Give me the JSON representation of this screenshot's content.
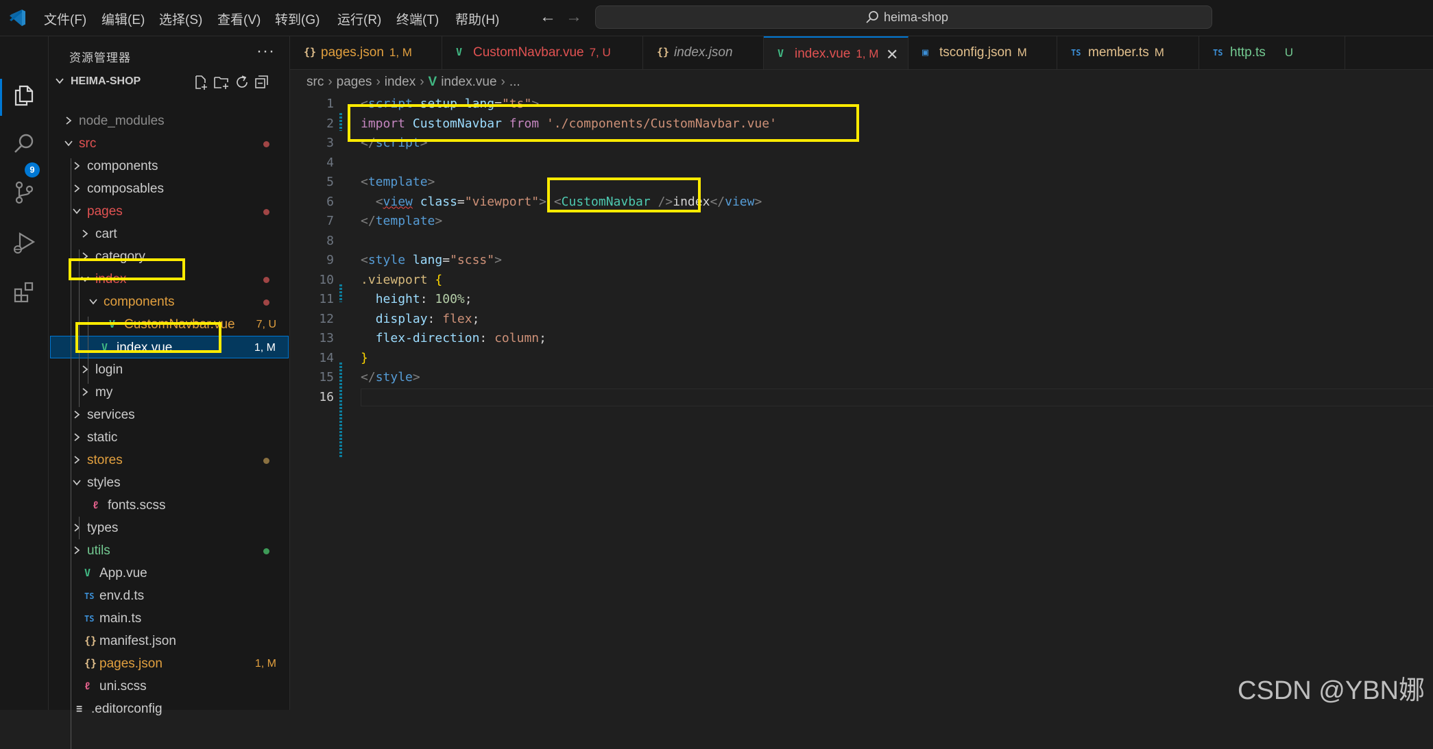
{
  "menu": {
    "items": [
      "文件(F)",
      "编辑(E)",
      "选择(S)",
      "查看(V)",
      "转到(G)",
      "运行(R)",
      "终端(T)",
      "帮助(H)"
    ]
  },
  "nav": {
    "back": "←",
    "forward": "→"
  },
  "search": {
    "text": "heima-shop"
  },
  "activity": {
    "scm_badge": "9"
  },
  "sidebar": {
    "title": "资源管理器",
    "more": "···",
    "workspace": "HEIMA-SHOP",
    "tree": [
      {
        "label": "node_modules",
        "type": "folder",
        "expanded": false,
        "depth": 1,
        "color": "#8c8c8c"
      },
      {
        "label": "src",
        "type": "folder",
        "expanded": true,
        "depth": 1,
        "color": "#e05252",
        "dot": "#a04545"
      },
      {
        "label": "components",
        "type": "folder",
        "expanded": false,
        "depth": 2,
        "color": "#cccccc"
      },
      {
        "label": "composables",
        "type": "folder",
        "expanded": false,
        "depth": 2,
        "color": "#cccccc"
      },
      {
        "label": "pages",
        "type": "folder",
        "expanded": true,
        "depth": 2,
        "color": "#e05252",
        "dot": "#a04545"
      },
      {
        "label": "cart",
        "type": "folder",
        "expanded": false,
        "depth": 3,
        "color": "#cccccc"
      },
      {
        "label": "category",
        "type": "folder",
        "expanded": false,
        "depth": 3,
        "color": "#cccccc"
      },
      {
        "label": "index",
        "type": "folder",
        "expanded": true,
        "depth": 3,
        "color": "#e05252",
        "dot": "#a04545"
      },
      {
        "label": "components",
        "type": "folder",
        "expanded": true,
        "depth": 4,
        "color": "#e2a03f",
        "dot": "#a04545"
      },
      {
        "label": "CustomNavbar.vue",
        "type": "vue",
        "depth": 5,
        "color": "#e2a03f",
        "badge": "7, U",
        "badge_color": "#e2a03f"
      },
      {
        "label": "index.vue",
        "type": "vue",
        "depth": 4,
        "color": "#ffffff",
        "badge": "1, M",
        "badge_color": "#ffffff",
        "selected": true
      },
      {
        "label": "login",
        "type": "folder",
        "expanded": false,
        "depth": 3,
        "color": "#cccccc"
      },
      {
        "label": "my",
        "type": "folder",
        "expanded": false,
        "depth": 3,
        "color": "#cccccc"
      },
      {
        "label": "services",
        "type": "folder",
        "expanded": false,
        "depth": 2,
        "color": "#cccccc"
      },
      {
        "label": "static",
        "type": "folder",
        "expanded": false,
        "depth": 2,
        "color": "#cccccc"
      },
      {
        "label": "stores",
        "type": "folder",
        "expanded": false,
        "depth": 2,
        "color": "#e2a03f",
        "dot": "#8a7040"
      },
      {
        "label": "styles",
        "type": "folder",
        "expanded": true,
        "depth": 2,
        "color": "#cccccc"
      },
      {
        "label": "fonts.scss",
        "type": "scss",
        "depth": 3,
        "color": "#cccccc"
      },
      {
        "label": "types",
        "type": "folder",
        "expanded": false,
        "depth": 2,
        "color": "#cccccc"
      },
      {
        "label": "utils",
        "type": "folder",
        "expanded": false,
        "depth": 2,
        "color": "#73c991",
        "dot": "#3d9a57"
      },
      {
        "label": "App.vue",
        "type": "vue",
        "depth": 2,
        "color": "#cccccc"
      },
      {
        "label": "env.d.ts",
        "type": "ts",
        "depth": 2,
        "color": "#cccccc"
      },
      {
        "label": "main.ts",
        "type": "ts",
        "depth": 2,
        "color": "#cccccc"
      },
      {
        "label": "manifest.json",
        "type": "json",
        "depth": 2,
        "color": "#cccccc"
      },
      {
        "label": "pages.json",
        "type": "json",
        "depth": 2,
        "color": "#e2a03f",
        "badge": "1, M",
        "badge_color": "#e2a03f"
      },
      {
        "label": "uni.scss",
        "type": "scss",
        "depth": 2,
        "color": "#cccccc"
      },
      {
        "label": ".editorconfig",
        "type": "config",
        "depth": 1,
        "color": "#cccccc"
      }
    ]
  },
  "tabs": [
    {
      "label": "pages.json",
      "status": "1, M",
      "type": "json",
      "color": "#e2a03f",
      "italic": false
    },
    {
      "label": "CustomNavbar.vue",
      "status": "7, U",
      "type": "vue",
      "color": "#e05252",
      "italic": false
    },
    {
      "label": "index.json",
      "status": "",
      "type": "json",
      "color": "#9d9d9d",
      "italic": true
    },
    {
      "label": "index.vue",
      "status": "1, M",
      "type": "vue",
      "color": "#e05252",
      "italic": false,
      "active": true,
      "close": "✕"
    },
    {
      "label": "tsconfig.json",
      "status": "M",
      "type": "tsconfig",
      "color": "#e2c08d",
      "italic": false
    },
    {
      "label": "member.ts",
      "status": "M",
      "type": "ts",
      "color": "#e2c08d",
      "italic": false
    },
    {
      "label": "http.ts",
      "status": "U",
      "type": "ts",
      "color": "#73c991",
      "italic": false
    }
  ],
  "breadcrumb": {
    "parts": [
      "src",
      "pages",
      "index"
    ],
    "file": "index.vue",
    "tail": "..."
  },
  "editor": {
    "current_line": 16,
    "lines": [
      [
        [
          "<",
          "tk-punc"
        ],
        [
          "script",
          "tk-tag"
        ],
        [
          " ",
          ""
        ],
        [
          "setup",
          "tk-attr"
        ],
        [
          " ",
          ""
        ],
        [
          "lang",
          "tk-attr"
        ],
        [
          "=",
          "tk-text"
        ],
        [
          "\"ts\"",
          "tk-str"
        ],
        [
          ">",
          "tk-punc"
        ]
      ],
      [
        [
          "import",
          "tk-kw"
        ],
        [
          " ",
          ""
        ],
        [
          "CustomNavbar",
          "tk-var"
        ],
        [
          " ",
          ""
        ],
        [
          "from",
          "tk-kw"
        ],
        [
          " ",
          ""
        ],
        [
          "'./components/CustomNavbar.vue'",
          "tk-str"
        ]
      ],
      [
        [
          "</",
          "tk-punc"
        ],
        [
          "script",
          "tk-tag"
        ],
        [
          ">",
          "tk-punc"
        ]
      ],
      [],
      [
        [
          "<",
          "tk-punc"
        ],
        [
          "template",
          "tk-tag"
        ],
        [
          ">",
          "tk-punc"
        ]
      ],
      [
        [
          "  ",
          ""
        ],
        [
          "<",
          "tk-punc"
        ],
        [
          "view",
          "tk-tag squiggle"
        ],
        [
          " ",
          ""
        ],
        [
          "class",
          "tk-attr"
        ],
        [
          "=",
          "tk-text"
        ],
        [
          "\"viewport\"",
          "tk-str"
        ],
        [
          ">",
          "tk-punc"
        ],
        [
          " ",
          ""
        ],
        [
          "<",
          "tk-punc"
        ],
        [
          "CustomNavbar",
          "tk-comp"
        ],
        [
          " ",
          ""
        ],
        [
          "/>",
          "tk-punc"
        ],
        [
          "index",
          "tk-text"
        ],
        [
          "</",
          "tk-punc"
        ],
        [
          "view",
          "tk-tag"
        ],
        [
          ">",
          "tk-punc"
        ]
      ],
      [
        [
          "</",
          "tk-punc"
        ],
        [
          "template",
          "tk-tag"
        ],
        [
          ">",
          "tk-punc"
        ]
      ],
      [],
      [
        [
          "<",
          "tk-punc"
        ],
        [
          "style",
          "tk-tag"
        ],
        [
          " ",
          ""
        ],
        [
          "lang",
          "tk-attr"
        ],
        [
          "=",
          "tk-text"
        ],
        [
          "\"scss\"",
          "tk-str"
        ],
        [
          ">",
          "tk-punc"
        ]
      ],
      [
        [
          ".viewport",
          "tk-sel"
        ],
        [
          " ",
          ""
        ],
        [
          "{",
          "tk-br"
        ]
      ],
      [
        [
          "  ",
          ""
        ],
        [
          "height",
          "tk-attr"
        ],
        [
          ": ",
          "tk-text"
        ],
        [
          "100%",
          "tk-num"
        ],
        [
          ";",
          "tk-text"
        ]
      ],
      [
        [
          "  ",
          ""
        ],
        [
          "display",
          "tk-attr"
        ],
        [
          ": ",
          "tk-text"
        ],
        [
          "flex",
          "tk-str"
        ],
        [
          ";",
          "tk-text"
        ]
      ],
      [
        [
          "  ",
          ""
        ],
        [
          "flex-direction",
          "tk-attr"
        ],
        [
          ": ",
          "tk-text"
        ],
        [
          "column",
          "tk-str"
        ],
        [
          ";",
          "tk-text"
        ]
      ],
      [
        [
          "}",
          "tk-br"
        ]
      ],
      [
        [
          "</",
          "tk-punc"
        ],
        [
          "style",
          "tk-tag"
        ],
        [
          ">",
          "tk-punc"
        ]
      ],
      []
    ]
  },
  "colors": {
    "accent": "#0078d4",
    "highlight_box": "#ffeb00",
    "modified": "#e2c08d",
    "untracked": "#73c991",
    "error": "#e05252"
  },
  "watermark": "CSDN @YBN娜"
}
